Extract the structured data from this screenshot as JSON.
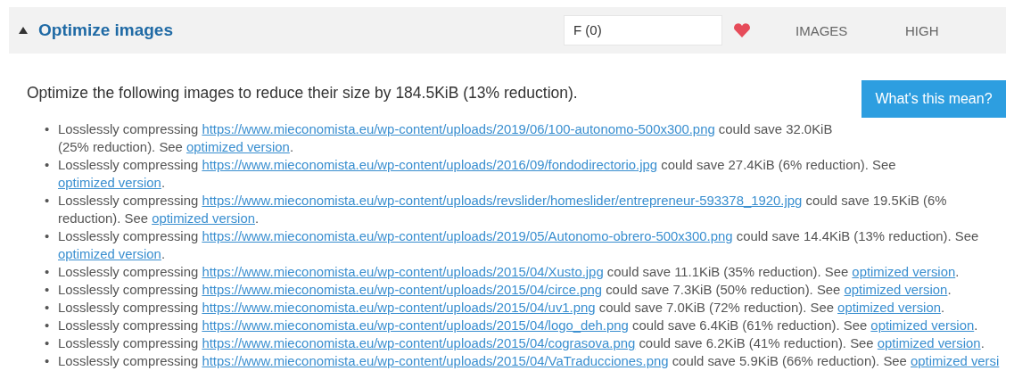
{
  "rule": {
    "expanded": true,
    "title": "Optimize images",
    "grade": "F (0)",
    "category": "IMAGES",
    "priority": "HIGH"
  },
  "summary": "Optimize the following images to reduce their size by 184.5KiB (13% reduction).",
  "help_button": "What's this mean?",
  "bullet": "•",
  "items": [
    {
      "before": "Losslessly compressing",
      "url": "https://www.mieconomista.eu/wp-content/uploads/2019/06/100-autonomo-500x300.png",
      "after": "could save 32.0KiB (25% reduction). See",
      "link": "optimized version",
      "end": "."
    },
    {
      "before": "Losslessly compressing",
      "url": "https://www.mieconomista.eu/wp-content/uploads/2016/09/fondodirectorio.jpg",
      "after": "could save 27.4KiB (6% reduction). See",
      "link": "optimized version",
      "end": "."
    },
    {
      "before": "Losslessly compressing",
      "url": "https://www.mieconomista.eu/wp-content/uploads/revslider/homeslider/entrepreneur-593378_1920.jpg",
      "after": "could save 19.5KiB (6% reduction). See",
      "link": "optimized version",
      "end": "."
    },
    {
      "before": "Losslessly compressing",
      "url": "https://www.mieconomista.eu/wp-content/uploads/2019/05/Autonomo-obrero-500x300.png",
      "after": "could save 14.4KiB (13% reduction). See",
      "link": "optimized version",
      "end": "."
    },
    {
      "before": "Losslessly compressing",
      "url": "https://www.mieconomista.eu/wp-content/uploads/2015/04/Xusto.jpg",
      "after": "could save 11.1KiB (35% reduction). See",
      "link": "optimized version",
      "end": "."
    },
    {
      "before": "Losslessly compressing",
      "url": "https://www.mieconomista.eu/wp-content/uploads/2015/04/circe.png",
      "after": "could save 7.3KiB (50% reduction). See",
      "link": "optimized version",
      "end": "."
    },
    {
      "before": "Losslessly compressing",
      "url": "https://www.mieconomista.eu/wp-content/uploads/2015/04/uv1.png",
      "after": "could save 7.0KiB (72% reduction). See",
      "link": "optimized version",
      "end": "."
    },
    {
      "before": "Losslessly compressing",
      "url": "https://www.mieconomista.eu/wp-content/uploads/2015/04/logo_deh.png",
      "after": "could save 6.4KiB (61% reduction). See",
      "link": "optimized version",
      "end": "."
    },
    {
      "before": "Losslessly compressing",
      "url": "https://www.mieconomista.eu/wp-content/uploads/2015/04/cograsova.png",
      "after": "could save 6.2KiB (41% reduction). See",
      "link": "optimized version",
      "end": "."
    },
    {
      "before": "Losslessly compressing",
      "url": "https://www.mieconomista.eu/wp-content/uploads/2015/04/VaTraducciones.png",
      "after": "could save 5.9KiB (66% reduction). See",
      "link": "optimized versi"
    }
  ]
}
